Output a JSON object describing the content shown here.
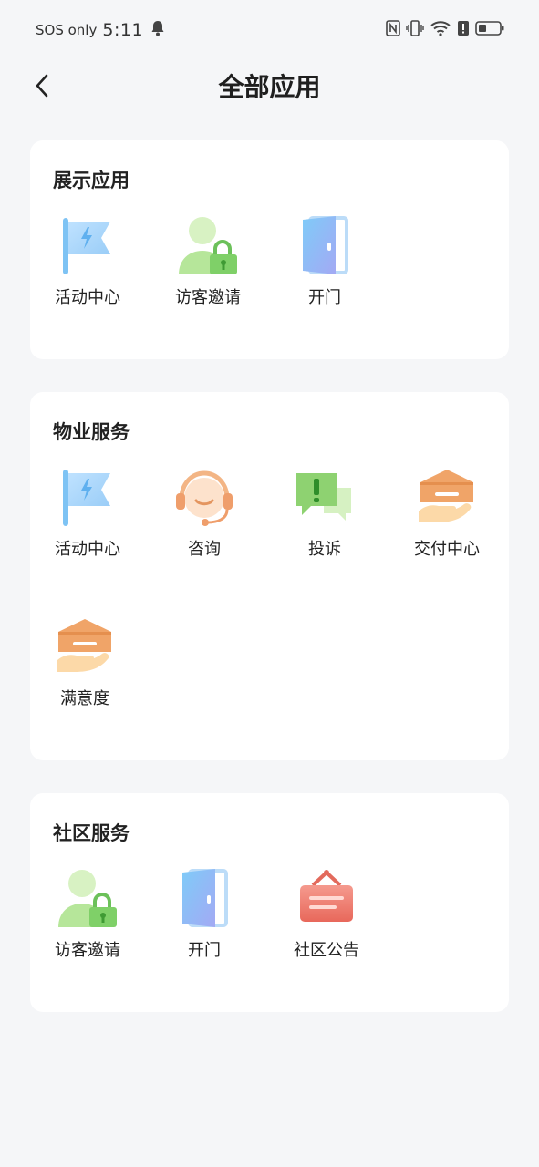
{
  "status_bar": {
    "carrier": "SOS only",
    "time": "5:11",
    "icons": [
      "bell-icon",
      "nfc-icon",
      "vibrate-icon",
      "wifi-icon",
      "alert-icon",
      "battery-icon"
    ]
  },
  "header": {
    "title": "全部应用",
    "back_icon": "chevron-left-icon"
  },
  "sections": [
    {
      "title": "展示应用",
      "apps": [
        {
          "label": "活动中心",
          "icon": "flag-icon"
        },
        {
          "label": "访客邀请",
          "icon": "visitor-lock-icon"
        },
        {
          "label": "开门",
          "icon": "door-icon"
        }
      ]
    },
    {
      "title": "物业服务",
      "apps": [
        {
          "label": "活动中心",
          "icon": "flag-icon"
        },
        {
          "label": "咨询",
          "icon": "headset-icon"
        },
        {
          "label": "投诉",
          "icon": "complaint-chat-icon"
        },
        {
          "label": "交付中心",
          "icon": "house-hand-icon"
        },
        {
          "label": "满意度",
          "icon": "house-hand-icon"
        }
      ]
    },
    {
      "title": "社区服务",
      "apps": [
        {
          "label": "访客邀请",
          "icon": "visitor-lock-icon"
        },
        {
          "label": "开门",
          "icon": "door-icon"
        },
        {
          "label": "社区公告",
          "icon": "notice-board-icon"
        }
      ]
    }
  ]
}
